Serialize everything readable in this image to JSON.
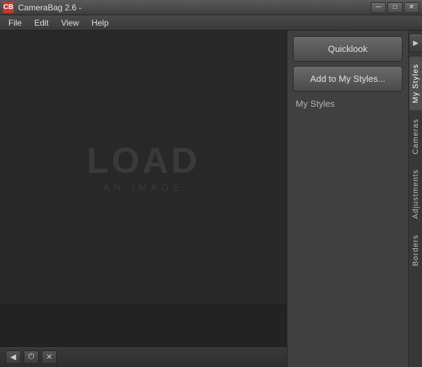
{
  "titleBar": {
    "appName": "CameraBag 2.6 -",
    "icon": "CB",
    "controls": {
      "minimize": "─",
      "maximize": "□",
      "close": "✕"
    }
  },
  "menuBar": {
    "items": [
      "File",
      "Edit",
      "View",
      "Help"
    ]
  },
  "canvas": {
    "loadText": "LOAD",
    "loadSubText": "AN IMAGE"
  },
  "bottomToolbar": {
    "buttons": [
      {
        "label": "◀",
        "name": "prev-button"
      },
      {
        "label": "⏻",
        "name": "power-button"
      },
      {
        "label": "✕",
        "name": "close-button"
      }
    ]
  },
  "rightPanel": {
    "quicklookLabel": "Quicklook",
    "addStylesLabel": "Add to My Styles...",
    "myStylesLabel": "My Styles",
    "expandArrow": "▶",
    "tabs": [
      {
        "label": "My Styles",
        "name": "my-styles-tab",
        "active": true
      },
      {
        "label": "Cameras",
        "name": "cameras-tab",
        "active": false
      },
      {
        "label": "Adjustments",
        "name": "adjustments-tab",
        "active": false
      },
      {
        "label": "Borders",
        "name": "borders-tab",
        "active": false
      },
      {
        "label": "...",
        "name": "more-tab",
        "active": false
      }
    ]
  }
}
